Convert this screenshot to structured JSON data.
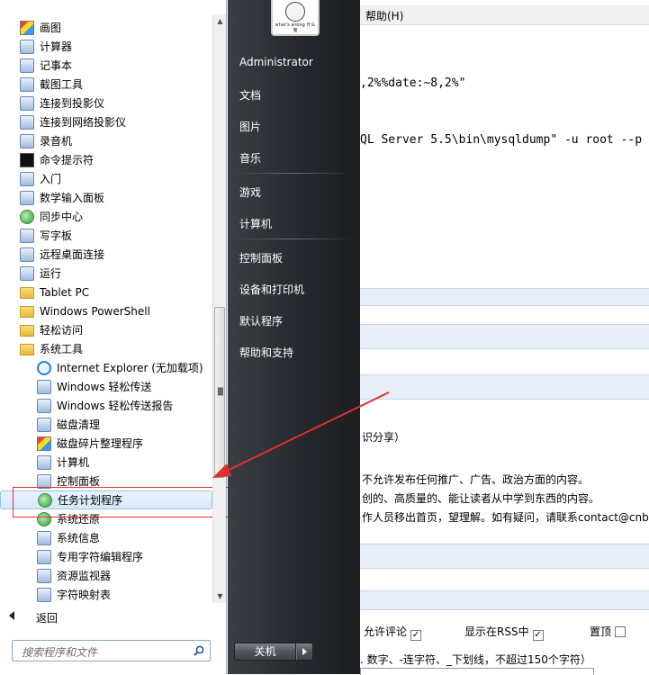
{
  "background_app": {
    "menu_help": "帮助(H)",
    "code_lines": [
      ",2%%date:~8,2%\"",
      "QL Server 5.5\\bin\\mysqldump\" -u root --p"
    ],
    "lines": [
      "识分享）",
      "不允许发布任何推广、广告、政治方面的内容。",
      "创的、高质量的、能让读者从中学到东西的内容。",
      "作人员移出首页，望理解。如有疑问，请联系contact@cnbl"
    ],
    "options": {
      "allow_comment": "允许评论",
      "show_in_rss": "显示在RSS中",
      "pin_top": "置顶"
    },
    "slug_hint": ". 数字、-连字符、_下划线，不超过150个字符）"
  },
  "start_menu": {
    "programs": [
      {
        "label": "画图",
        "icon": "paint-icon",
        "level": 1
      },
      {
        "label": "计算器",
        "icon": "calculator-icon",
        "level": 1
      },
      {
        "label": "记事本",
        "icon": "notepad-icon",
        "level": 1
      },
      {
        "label": "截图工具",
        "icon": "snipping-tool-icon",
        "level": 1
      },
      {
        "label": "连接到投影仪",
        "icon": "projector-icon",
        "level": 1
      },
      {
        "label": "连接到网络投影仪",
        "icon": "network-projector-icon",
        "level": 1
      },
      {
        "label": "录音机",
        "icon": "microphone-icon",
        "level": 1
      },
      {
        "label": "命令提示符",
        "icon": "cmd-icon",
        "level": 1
      },
      {
        "label": "入门",
        "icon": "getting-started-icon",
        "level": 1
      },
      {
        "label": "数学输入面板",
        "icon": "math-input-icon",
        "level": 1
      },
      {
        "label": "同步中心",
        "icon": "sync-center-icon",
        "level": 1
      },
      {
        "label": "写字板",
        "icon": "wordpad-icon",
        "level": 1
      },
      {
        "label": "远程桌面连接",
        "icon": "remote-desktop-icon",
        "level": 1
      },
      {
        "label": "运行",
        "icon": "run-icon",
        "level": 1
      },
      {
        "label": "Tablet PC",
        "icon": "folder-icon",
        "level": 1
      },
      {
        "label": "Windows PowerShell",
        "icon": "folder-icon",
        "level": 1
      },
      {
        "label": "轻松访问",
        "icon": "folder-icon",
        "level": 1
      },
      {
        "label": "系统工具",
        "icon": "folder-icon",
        "level": 1
      },
      {
        "label": "Internet Explorer (无加载项)",
        "icon": "ie-icon",
        "level": 2
      },
      {
        "label": "Windows 轻松传送",
        "icon": "easy-transfer-icon",
        "level": 2
      },
      {
        "label": "Windows 轻松传送报告",
        "icon": "easy-transfer-report-icon",
        "level": 2
      },
      {
        "label": "磁盘清理",
        "icon": "disk-cleanup-icon",
        "level": 2
      },
      {
        "label": "磁盘碎片整理程序",
        "icon": "defrag-icon",
        "level": 2
      },
      {
        "label": "计算机",
        "icon": "computer-icon",
        "level": 2
      },
      {
        "label": "控制面板",
        "icon": "control-panel-icon",
        "level": 2
      },
      {
        "label": "任务计划程序",
        "icon": "clock-icon",
        "level": 2,
        "selected": true
      },
      {
        "label": "系统还原",
        "icon": "system-restore-icon",
        "level": 2
      },
      {
        "label": "系统信息",
        "icon": "system-info-icon",
        "level": 2
      },
      {
        "label": "专用字符编辑程序",
        "icon": "char-editor-icon",
        "level": 2
      },
      {
        "label": "资源监视器",
        "icon": "resource-monitor-icon",
        "level": 2
      },
      {
        "label": "字符映射表",
        "icon": "charmap-icon",
        "level": 2
      }
    ],
    "back_label": "返回",
    "search_placeholder": "搜索程序和文件",
    "right_links": [
      "Administrator",
      "文档",
      "图片",
      "音乐",
      "游戏",
      "计算机",
      "控制面板",
      "设备和打印机",
      "默认程序",
      "帮助和支持"
    ],
    "user_pic_caption": "what's wrong 什么鬼",
    "shutdown_label": "关机"
  },
  "colors": {
    "annotation": "#e03030",
    "selected_bg": "#d7e8fb",
    "dark_pane": "#25282c"
  }
}
